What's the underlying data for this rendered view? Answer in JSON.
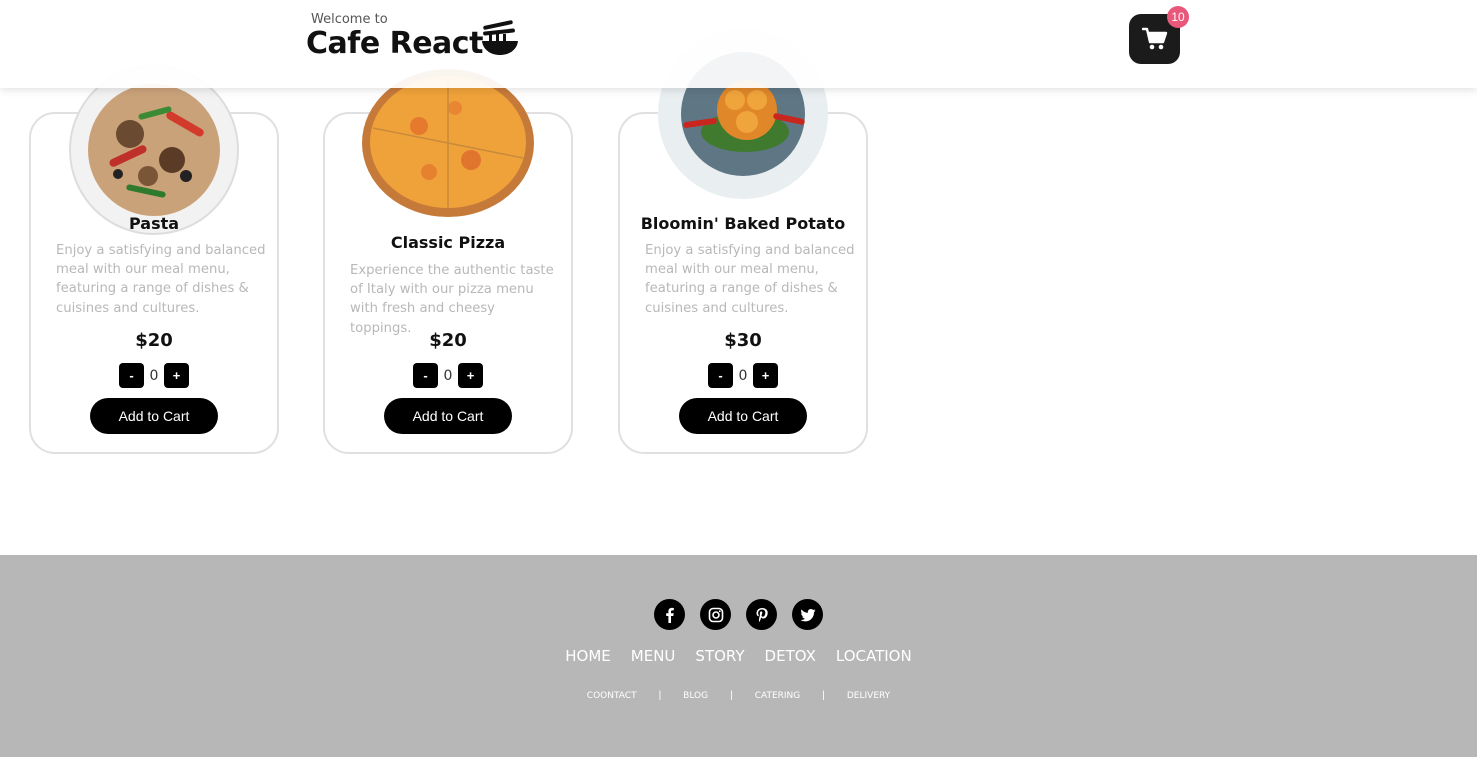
{
  "header": {
    "welcome": "Welcome to",
    "brand": "Cafe React",
    "logo_icon": "noodle-bowl-icon",
    "cart_icon": "shopping-cart-icon",
    "cart_count": "10"
  },
  "menu": {
    "items": [
      {
        "title": "Pasta",
        "description": "Enjoy a satisfying and balanced meal with our meal menu, featuring a range of dishes & cuisines and cultures.",
        "price": "$20",
        "quantity": "0",
        "minus": "-",
        "plus": "+",
        "button": "Add to Cart"
      },
      {
        "title": "Classic Pizza",
        "description": "Experience the authentic taste of Italy with our pizza menu with fresh and cheesy toppings.",
        "price": "$20",
        "quantity": "0",
        "minus": "-",
        "plus": "+",
        "button": "Add to Cart"
      },
      {
        "title": "Bloomin' Baked Potato",
        "description": "Enjoy a satisfying and balanced meal with our meal menu, featuring a range of dishes & cuisines and cultures.",
        "price": "$30",
        "quantity": "0",
        "minus": "-",
        "plus": "+",
        "button": "Add to Cart"
      }
    ]
  },
  "footer": {
    "social_icons": [
      "facebook-icon",
      "instagram-icon",
      "pinterest-icon",
      "twitter-icon"
    ],
    "nav": [
      "HOME",
      "MENU",
      "STORY",
      "DETOX",
      "LOCATION"
    ],
    "subnav": [
      "COONTACT",
      "BLOG",
      "CATERING",
      "DELIVERY"
    ],
    "separator": "|"
  },
  "colors": {
    "footer_bg": "#b7b7b7",
    "badge": "#e8587a",
    "button": "#000000",
    "description": "#b8b8b8"
  }
}
